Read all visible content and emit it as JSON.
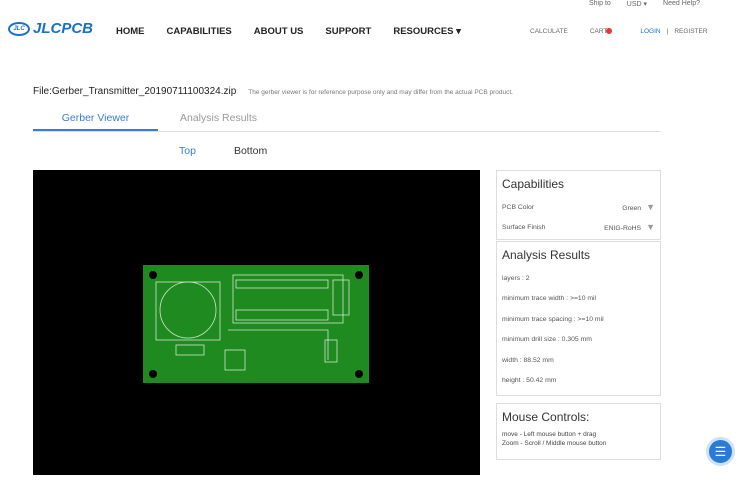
{
  "topbar": {
    "ship_to": "Ship to",
    "currency": "USD ▾",
    "help": "Need Help?"
  },
  "logo": {
    "badge": "JLC",
    "text": "JLCPCB"
  },
  "nav": [
    "HOME",
    "CAPABILITIES",
    "ABOUT US",
    "SUPPORT",
    "RESOURCES ▾"
  ],
  "right_nav": {
    "calculate": "CALCULATE",
    "cart": "CART",
    "login": "LOGIN",
    "separator": "|",
    "register": "REGISTER"
  },
  "file": {
    "name": "File:Gerber_Transmitter_20190711100324.zip",
    "note": "The gerber viewer is for reference purpose only and may differ from the actual PCB product."
  },
  "tabs": [
    {
      "label": "Gerber Viewer",
      "active": true
    },
    {
      "label": "Analysis Results",
      "active": false
    }
  ],
  "sides": [
    {
      "label": "Top",
      "active": true
    },
    {
      "label": "Bottom",
      "active": false
    }
  ],
  "capabilities": {
    "title": "Capabilities",
    "rows": [
      {
        "label": "PCB Color",
        "value": "Green"
      },
      {
        "label": "Surface Finish",
        "value": "ENIG-RoHS"
      }
    ]
  },
  "analysis": {
    "title": "Analysis Results",
    "items": [
      "layers : 2",
      "minimum trace width : >=10 mil",
      "minimum trace spacing : >=10 mil",
      "minimum drill size : 0.305 mm",
      "width : 88.52 mm",
      "height : 50.42 mm"
    ]
  },
  "mouse": {
    "title": "Mouse Controls:",
    "items": [
      "move - Left mouse button + drag",
      "Zoom - Scroll / Middle mouse button"
    ]
  },
  "colors": {
    "accent": "#3a7dd0",
    "pcb": "#1f8a1f",
    "viewer_bg": "#000000"
  }
}
